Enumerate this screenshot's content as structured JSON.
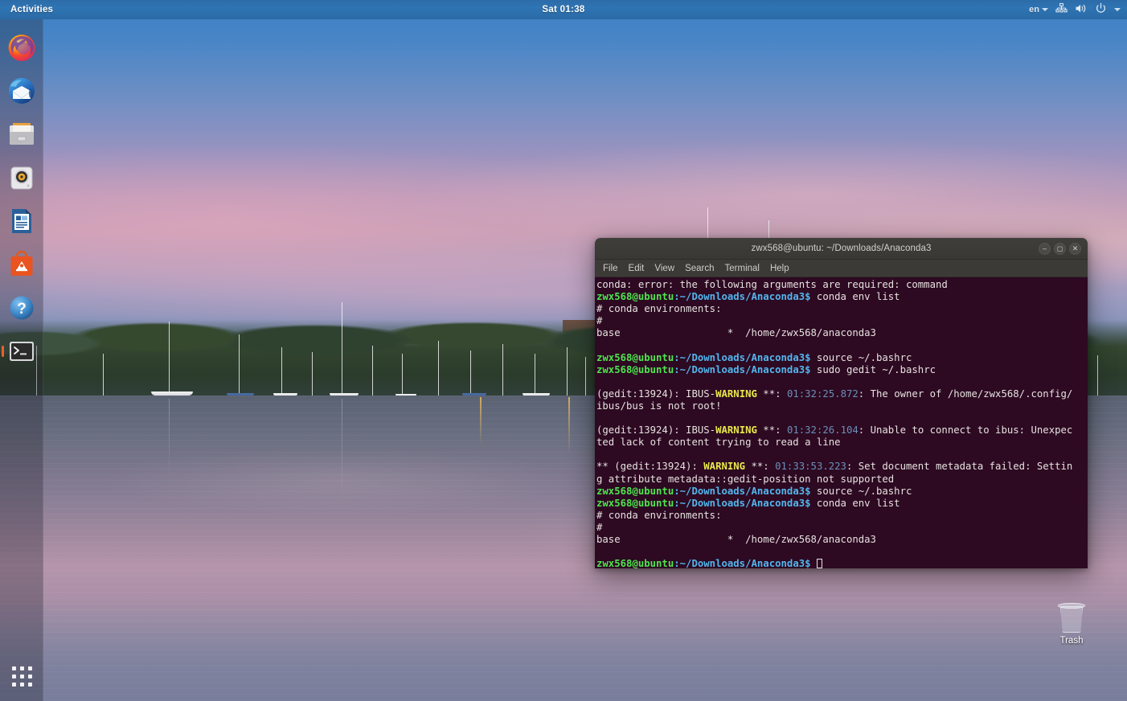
{
  "panel": {
    "activities_label": "Activities",
    "clock": "Sat 01:38",
    "keyboard_layout": "en",
    "icons": [
      "network-icon",
      "volume-icon",
      "power-icon",
      "chevron-down-icon"
    ]
  },
  "dock": {
    "items": [
      {
        "name": "firefox",
        "label": "Firefox",
        "running": false
      },
      {
        "name": "thunderbird",
        "label": "Thunderbird",
        "running": false
      },
      {
        "name": "files",
        "label": "Files",
        "running": false
      },
      {
        "name": "rhythmbox",
        "label": "Rhythmbox",
        "running": false
      },
      {
        "name": "libreoffice-writer",
        "label": "LibreOffice Writer",
        "running": false
      },
      {
        "name": "ubuntu-software",
        "label": "Ubuntu Software",
        "running": false
      },
      {
        "name": "help",
        "label": "Help",
        "running": false
      },
      {
        "name": "terminal",
        "label": "Terminal",
        "running": true
      }
    ],
    "show_applications_label": "Show Applications"
  },
  "desktop": {
    "trash_label": "Trash"
  },
  "terminal": {
    "title": "zwx568@ubuntu: ~/Downloads/Anaconda3",
    "menu": [
      "File",
      "Edit",
      "View",
      "Search",
      "Terminal",
      "Help"
    ],
    "window_controls": [
      "minimize",
      "maximize",
      "close"
    ],
    "colors": {
      "background": "#2d0922",
      "foreground": "#e6e2df",
      "user_host": "#4fe44f",
      "path": "#52b6ec",
      "warning": "#e8e84a",
      "timestamp": "#6a90b8",
      "titlebar": "#3c3b37"
    },
    "prompt_user_host": "zwx568@ubuntu",
    "prompt_path": ":~/Downloads/Anaconda3$",
    "lines": [
      {
        "type": "plain",
        "text": "conda: error: the following arguments are required: command"
      },
      {
        "type": "prompt",
        "command": " conda env list"
      },
      {
        "type": "plain",
        "text": "# conda environments:"
      },
      {
        "type": "plain",
        "text": "#"
      },
      {
        "type": "plain",
        "text": "base                  *  /home/zwx568/anaconda3"
      },
      {
        "type": "blank",
        "text": ""
      },
      {
        "type": "prompt",
        "command": " source ~/.bashrc"
      },
      {
        "type": "prompt",
        "command": " sudo gedit ~/.bashrc"
      },
      {
        "type": "blank",
        "text": ""
      },
      {
        "type": "warning",
        "prefix": "(gedit:13924): IBUS-",
        "tag": "WARNING",
        "mid": " **: ",
        "time": "01:32:25.872",
        "rest": ": The owner of /home/zwx568/.config/"
      },
      {
        "type": "plain",
        "text": "ibus/bus is not root!"
      },
      {
        "type": "blank",
        "text": ""
      },
      {
        "type": "warning",
        "prefix": "(gedit:13924): IBUS-",
        "tag": "WARNING",
        "mid": " **: ",
        "time": "01:32:26.104",
        "rest": ": Unable to connect to ibus: Unexpec"
      },
      {
        "type": "plain",
        "text": "ted lack of content trying to read a line"
      },
      {
        "type": "blank",
        "text": ""
      },
      {
        "type": "warning",
        "prefix": "** (gedit:13924): ",
        "tag": "WARNING",
        "mid": " **: ",
        "time": "01:33:53.223",
        "rest": ": Set document metadata failed: Settin"
      },
      {
        "type": "plain",
        "text": "g attribute metadata::gedit-position not supported"
      },
      {
        "type": "prompt",
        "command": " source ~/.bashrc"
      },
      {
        "type": "prompt",
        "command": " conda env list"
      },
      {
        "type": "plain",
        "text": "# conda environments:"
      },
      {
        "type": "plain",
        "text": "#"
      },
      {
        "type": "plain",
        "text": "base                  *  /home/zwx568/anaconda3"
      },
      {
        "type": "blank",
        "text": ""
      },
      {
        "type": "cursor-prompt",
        "command": " "
      }
    ]
  }
}
